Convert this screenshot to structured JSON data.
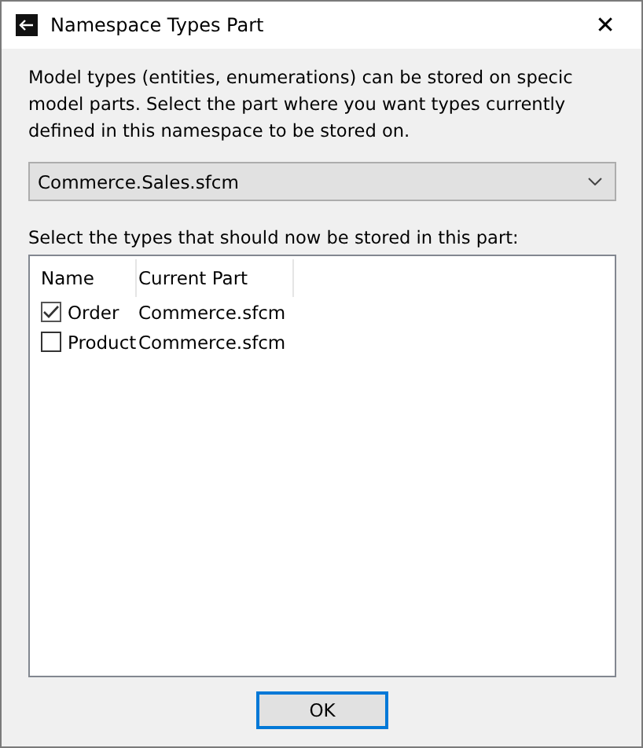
{
  "window": {
    "title": "Namespace Types Part",
    "close": "✕"
  },
  "description": "Model types (entities, enumerations) can be stored on specic model parts. Select the part where you want types currently defined in this namespace to be stored on.",
  "part_select": {
    "value": "Commerce.Sales.sfcm"
  },
  "types_label": "Select the types that should now be stored in this part:",
  "table": {
    "columns": [
      "Name",
      "Current Part"
    ],
    "rows": [
      {
        "name": "Order",
        "current_part": "Commerce.sfcm",
        "checked": true
      },
      {
        "name": "Product",
        "current_part": "Commerce.sfcm",
        "checked": false
      }
    ]
  },
  "buttons": [
    "OK"
  ]
}
